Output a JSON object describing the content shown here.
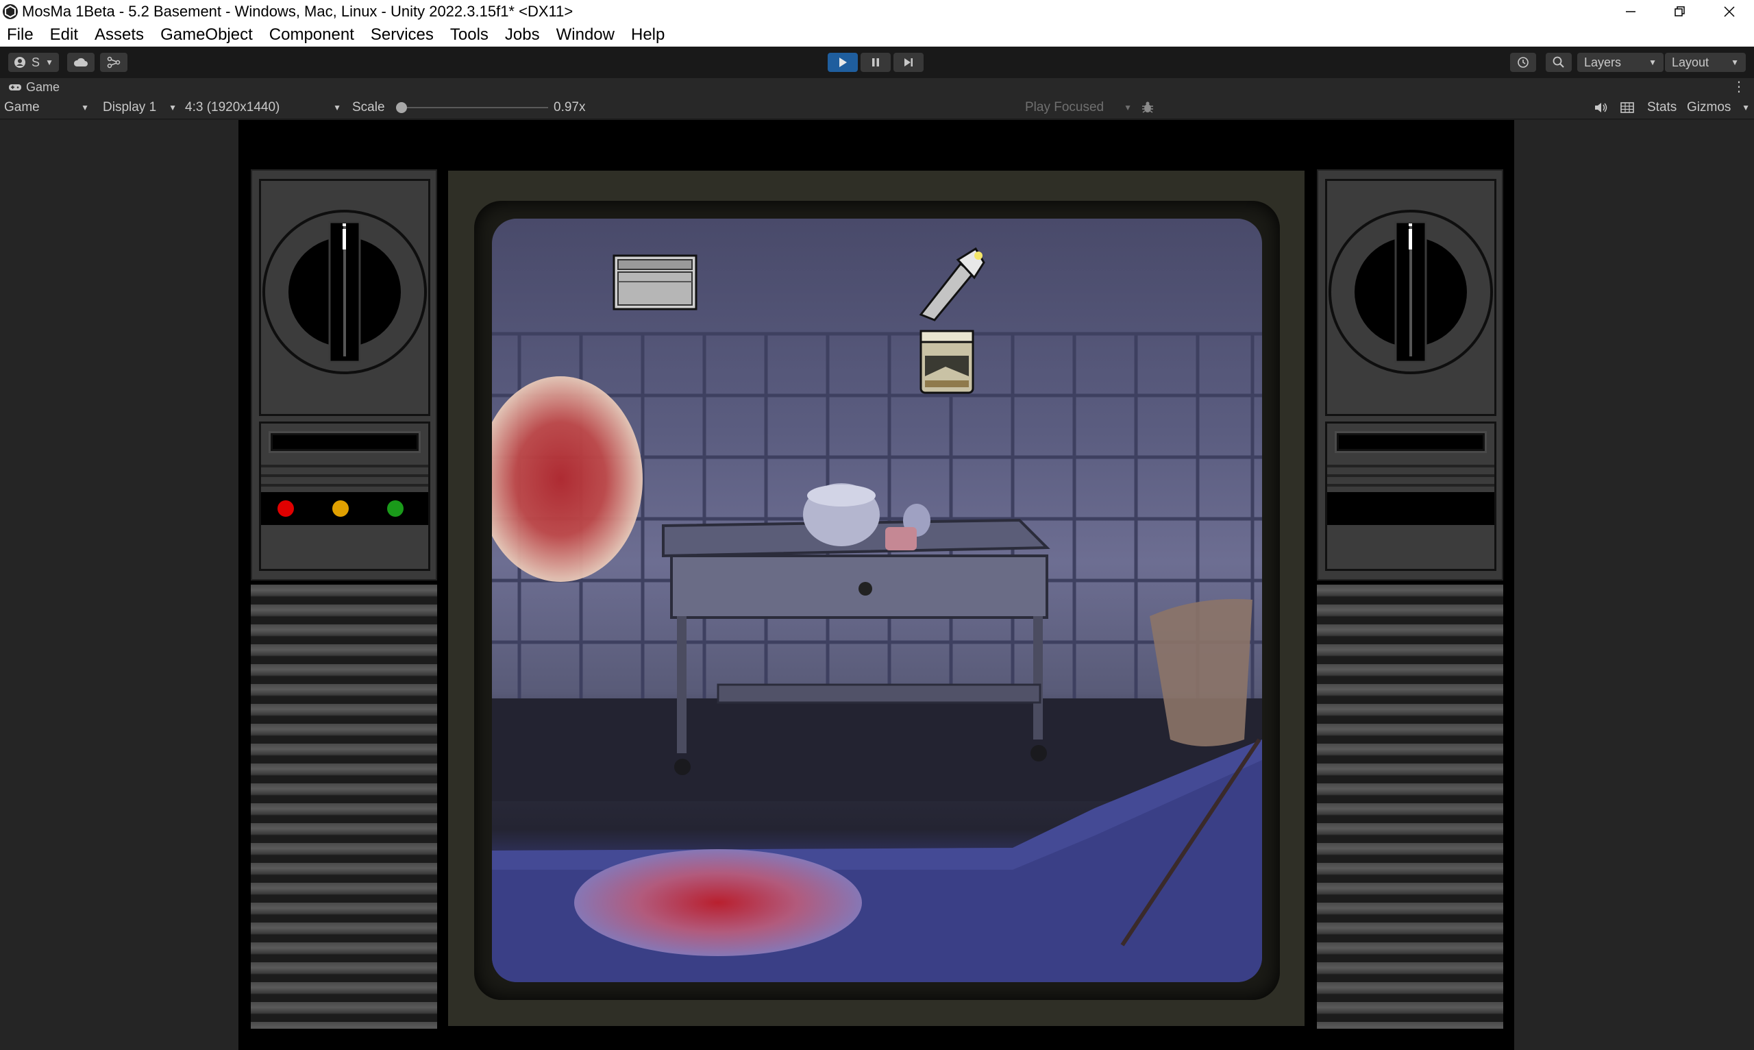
{
  "window": {
    "title": "MosMa 1Beta - 5.2 Basement - Windows, Mac, Linux - Unity 2022.3.15f1* <DX11>",
    "controls": [
      "minimize-icon",
      "restore-icon",
      "close-icon"
    ]
  },
  "menu": [
    "File",
    "Edit",
    "Assets",
    "GameObject",
    "Component",
    "Services",
    "Tools",
    "Jobs",
    "Window",
    "Help"
  ],
  "toolbar": {
    "account_label": "S",
    "right": {
      "layers_label": "Layers",
      "layout_label": "Layout"
    }
  },
  "tab": {
    "label": "Game"
  },
  "gamebar": {
    "view_mode": "Game",
    "display": "Display 1",
    "resolution": "4:3 (1920x1440)",
    "scale_label": "Scale",
    "scale_value": "0.97x",
    "scale_fraction": 0.02,
    "play_mode": "Play Focused",
    "stats_label": "Stats",
    "gizmos_label": "Gizmos"
  },
  "game": {
    "left_lights": [
      {
        "name": "red-light",
        "color": "#e00000"
      },
      {
        "name": "yellow-light",
        "color": "#e0a000"
      },
      {
        "name": "green-light",
        "color": "#1a9a1a"
      }
    ],
    "inventory": [
      "box-icon",
      "flashlight-icon",
      "jar-icon"
    ]
  },
  "colors": {
    "play_active": "#1f5e9e",
    "toolbar_bg": "#191919",
    "panel_bg": "#282828"
  }
}
